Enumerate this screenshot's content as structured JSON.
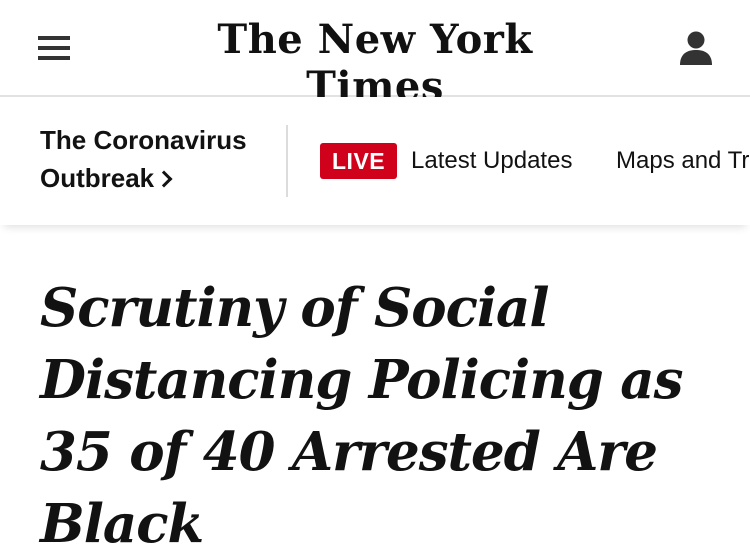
{
  "header": {
    "logo_text": "The New York Times",
    "menu_icon": "hamburger-menu-icon",
    "account_icon": "user-account-icon"
  },
  "subnav": {
    "section_line1": "The Coronavirus",
    "section_line2": "Outbreak",
    "live_badge": "LIVE",
    "links": [
      "Latest Updates",
      "Maps and Tr"
    ],
    "live_color": "#d0021b"
  },
  "article": {
    "headline": "Scrutiny of Social Distancing Policing as 35 of 40 Arrested Are Black"
  }
}
